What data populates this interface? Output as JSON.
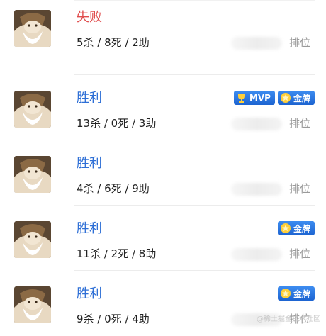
{
  "matches": [
    {
      "result": "失败",
      "outcome": "loss",
      "kda": "5杀 / 8死 / 2助",
      "rank": "排位",
      "badges": []
    },
    {
      "result": "胜利",
      "outcome": "win",
      "kda": "13杀 / 0死 / 3助",
      "rank": "排位",
      "badges": [
        "MVP",
        "金牌"
      ]
    },
    {
      "result": "胜利",
      "outcome": "win",
      "kda": "4杀 / 6死 / 9助",
      "rank": "排位",
      "badges": []
    },
    {
      "result": "胜利",
      "outcome": "win",
      "kda": "11杀 / 2死 / 8助",
      "rank": "排位",
      "badges": [
        "金牌"
      ]
    },
    {
      "result": "胜利",
      "outcome": "win",
      "kda": "9杀 / 0死 / 4助",
      "rank": "排位",
      "badges": [
        "金牌"
      ]
    }
  ],
  "colors": {
    "win": "#2e6fd6",
    "loss": "#e04d4d",
    "badge": "#1d64d1"
  },
  "watermark": "@稀土掘金技术社区",
  "icons": {
    "mvp_badge": "trophy-icon",
    "gold_badge": "gold-medal-icon",
    "avatar": "hero-avatar"
  }
}
